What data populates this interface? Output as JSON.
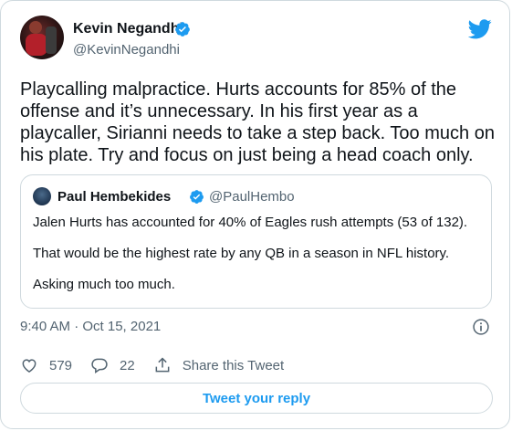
{
  "author": {
    "name": "Kevin Negandhi",
    "handle": "@KevinNegandhi"
  },
  "tweet": {
    "text": "Playcalling malpractice. Hurts accounts for 85% of the offense and it’s unnecessary. In his first year as a playcaller, Sirianni needs to take a step back. Too much on his plate. Try and focus on just being a head coach only.",
    "timestamp": "9:40 AM · Oct 15, 2021"
  },
  "quote": {
    "name": "Paul Hembekides",
    "handle": "@PaulHembo",
    "lines": [
      "Jalen Hurts has accounted for 40% of Eagles rush attempts (53 of 132).",
      "That would be the highest rate by any QB in a season in NFL history.",
      "Asking much too much."
    ]
  },
  "actions": {
    "likes": "579",
    "replies": "22",
    "share_label": "Share this Tweet"
  },
  "reply_button": "Tweet your reply",
  "colors": {
    "accent": "#1d9bf0",
    "secondary_text": "#536471",
    "border": "#cfd9de",
    "like_icon": "#536471"
  },
  "icons": [
    "verified-badge-icon",
    "twitter-bird-icon",
    "info-icon",
    "heart-icon",
    "reply-icon",
    "share-icon"
  ]
}
